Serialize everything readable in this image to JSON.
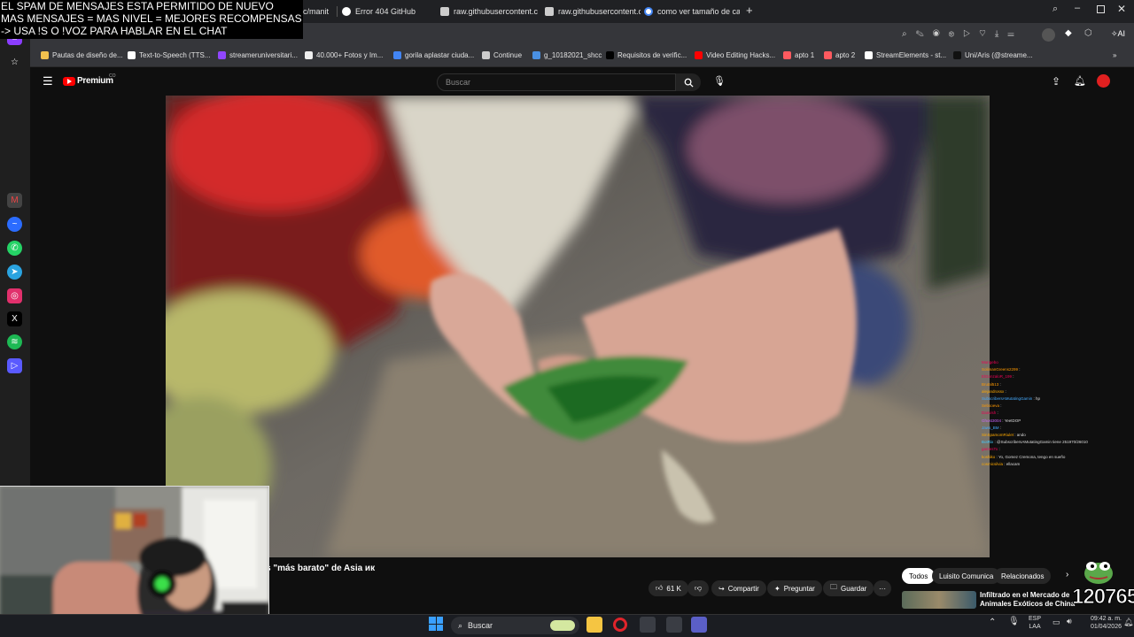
{
  "overlay": {
    "line1": "EL SPAM DE MENSAJES ESTA PERMITIDO DE NUEVO",
    "line2": "MAS MENSAJES = MAS NIVEL = MEJORES RECOMPENSAS",
    "line3": "-> USA !S  O !VOZ PARA HABLAR EN EL CHAT"
  },
  "tabs": [
    {
      "label": "c/manit",
      "icon": "page-icon"
    },
    {
      "label": "Error 404 GitHub",
      "icon": "github-icon"
    },
    {
      "label": "raw.githubusercontent.co",
      "icon": "page-icon"
    },
    {
      "label": "raw.githubusercontent.co",
      "icon": "page-icon"
    },
    {
      "label": "como ver tamaño de carp",
      "icon": "google-icon"
    }
  ],
  "bookmarks": [
    {
      "label": "Pautas de diseño de...",
      "color": "#f2c14e"
    },
    {
      "label": "Text-to-Speech (TTS...",
      "color": "#ffffff"
    },
    {
      "label": "streameruniversitari...",
      "color": "#9146ff"
    },
    {
      "label": "40.000+ Fotos y Im...",
      "color": "#eeeeee"
    },
    {
      "label": "gorila aplastar ciuda...",
      "color": "#4285f4"
    },
    {
      "label": "Continue",
      "color": "#cccccc"
    },
    {
      "label": "g_10182021_shcc",
      "color": "#4a90e2"
    },
    {
      "label": "Requisitos de verific...",
      "color": "#000000"
    },
    {
      "label": "Video Editing Hacks...",
      "color": "#ff0000"
    },
    {
      "label": "apto 1",
      "color": "#ff5a5f"
    },
    {
      "label": "apto 2",
      "color": "#ff5a5f"
    },
    {
      "label": "StreamElements - st...",
      "color": "#ffffff"
    },
    {
      "label": "Uni/Aris (@streame...",
      "color": "#111111"
    }
  ],
  "youtube": {
    "logo": "Premium",
    "logo_sup": "CO",
    "search_placeholder": "Buscar",
    "title": "s \"más barato\" de Asia ик",
    "likes": "61 K",
    "share": "Compartir",
    "ask": "Preguntar",
    "save": "Guardar",
    "chips": [
      "Todos",
      "Luisito Comunica",
      "Relacionados"
    ],
    "rec_title_1": "Infiltrado en el Mercado de",
    "rec_title_2": "Animales Exóticos de China"
  },
  "chat": [
    {
      "user": "Mongebo",
      "msg": "",
      "color": "#e05"
    },
    {
      "user": "SolimanGreens2299",
      "msg": ":",
      "color": "#f90"
    },
    {
      "user": "ElGonzaloR_199",
      "msg": ":",
      "color": "#e05"
    },
    {
      "user": "Brutal513",
      "msg": ":",
      "color": "#f90"
    },
    {
      "user": "alejandrossx",
      "msg": ":",
      "color": "#fa0"
    },
    {
      "user": "SubscribersAMutatingGamin",
      "msg": ": hp",
      "color": "#4af"
    },
    {
      "user": "Sebsoeva",
      "msg": ":",
      "color": "#f90"
    },
    {
      "user": "Danvish",
      "msg": ":",
      "color": "#e05"
    },
    {
      "user": "Ghost3004",
      "msg": ": YeetDOP",
      "color": "#c6f"
    },
    {
      "user": "Jaws_BM",
      "msg": ":",
      "color": "#4af"
    },
    {
      "user": "SinSpamomRiulet",
      "msg": ": ando",
      "color": "#fa0"
    },
    {
      "user": "BotRix",
      "msg": ": @SubscribersAMutatingGamin tiene 251970/2601000XP para subir de nivel",
      "color": "#4cf"
    },
    {
      "user": "gamesTo",
      "msg": ":",
      "color": "#e05"
    },
    {
      "user": "koshiko",
      "msg": ": Yo, Gomez Cremona, tengo en sueño",
      "color": "#fa0"
    },
    {
      "user": "cosmicsilvia",
      "msg": ": ellacam",
      "color": "#fa0"
    }
  ],
  "counter": "120765",
  "taskbar": {
    "search": "Buscar",
    "lang1": "ESP",
    "lang2": "LAA",
    "time": "09:42 a. m.",
    "date": "01/04/2026"
  },
  "toolbar": {
    "ai_label": "AI"
  }
}
